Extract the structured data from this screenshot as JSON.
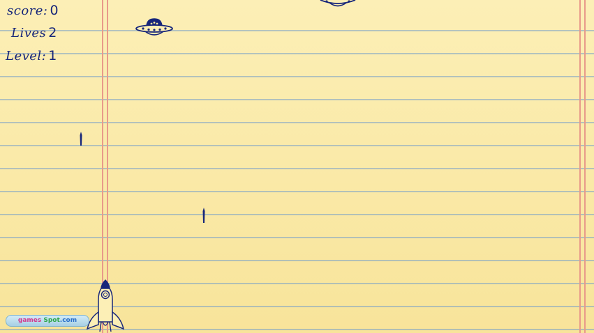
{
  "hud": {
    "score_label": "score:",
    "score_value": "0",
    "lives_label": "Lives",
    "lives_value": "2",
    "level_label": "Level:",
    "level_value": "1"
  },
  "logo": {
    "part1": "games",
    "part2": "Spot",
    "part3": ".com"
  },
  "colors": {
    "ink": "#17267a",
    "paper": "#fbe8a2",
    "rule_line": "#8fb4d6",
    "margin_line": "#e89a8a"
  },
  "sprites": {
    "player": "rocket-ship-icon",
    "enemy": "ufo-icon",
    "projectile": "bullet-icon"
  }
}
